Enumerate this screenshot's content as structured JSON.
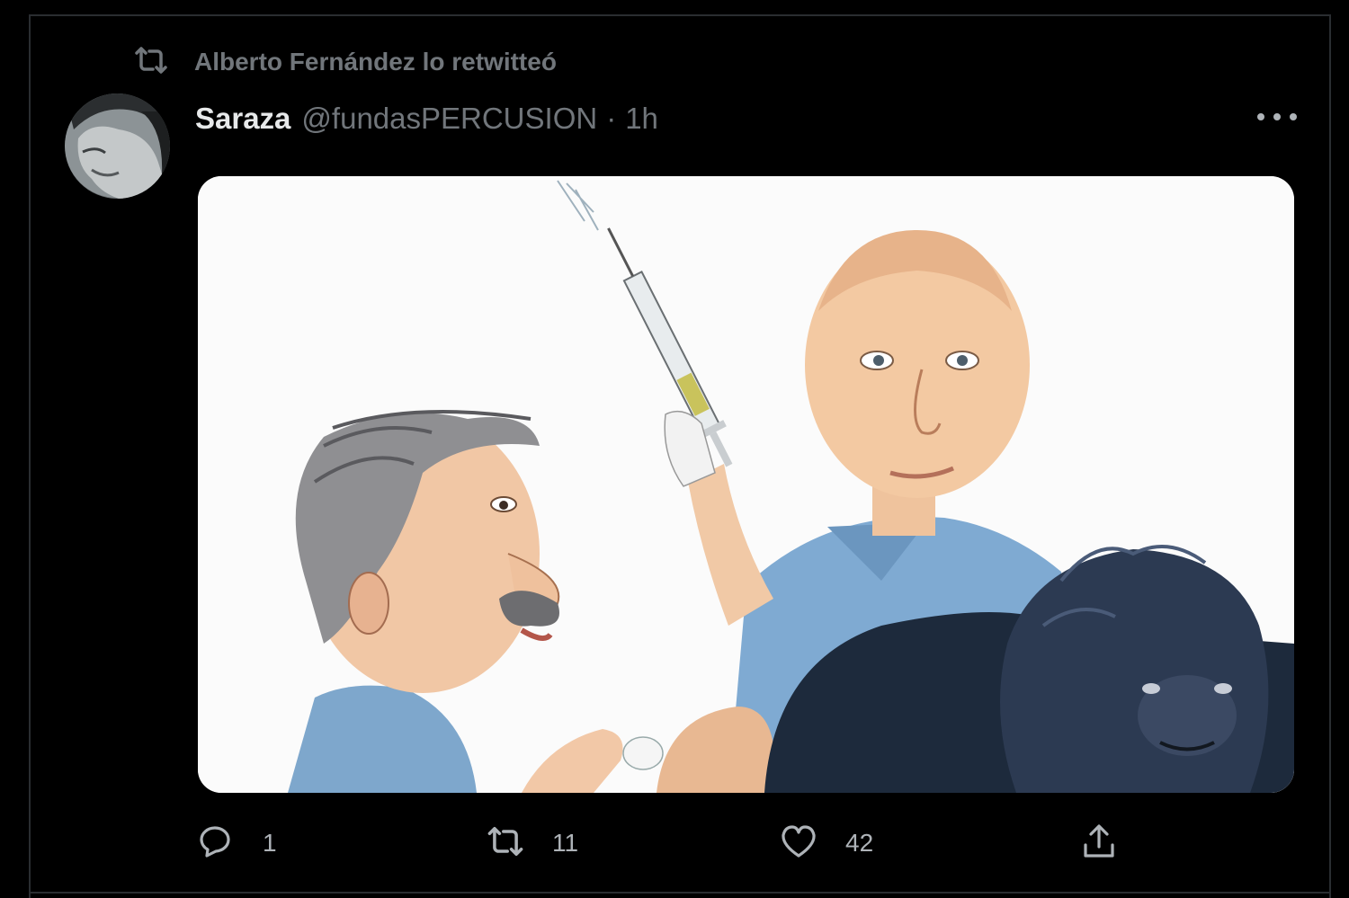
{
  "retweet_context": {
    "text": "Alberto Fernández lo retwitteó",
    "icon": "retweet-icon"
  },
  "tweet": {
    "author_name": "Saraza",
    "author_handle": "@fundasPERCUSION",
    "separator": "·",
    "timestamp": "1h",
    "more_icon": "more-icon",
    "media": {
      "kind": "caricature illustration"
    },
    "actions": {
      "reply": {
        "icon": "reply-icon",
        "count": "1"
      },
      "retweet": {
        "icon": "retweet-icon",
        "count": "11"
      },
      "like": {
        "icon": "heart-icon",
        "count": "42"
      },
      "share": {
        "icon": "share-icon"
      }
    }
  },
  "colors": {
    "background": "#000000",
    "secondary_text": "#71767b",
    "primary_text": "#e7e9ea"
  }
}
